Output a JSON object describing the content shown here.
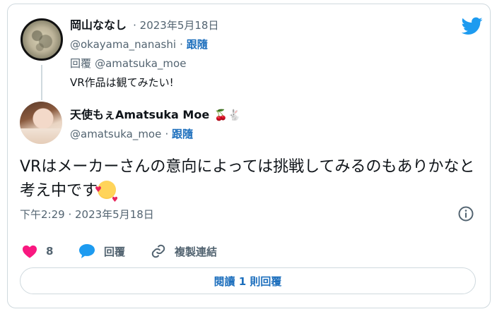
{
  "parent_tweet": {
    "display_name": "岡山ななし",
    "date": "· 2023年5月18日",
    "handle": "@okayama_nanashi",
    "follow_label": "跟隨",
    "replying_to_label": "回覆",
    "replying_to_handle": "@amatsuka_moe",
    "text": "VR作品は観てみたい!"
  },
  "main_tweet": {
    "display_name": "天使もぇAmatsuka Moe",
    "name_emojis": "🍒🐇",
    "handle": "@amatsuka_moe",
    "follow_label": "跟隨",
    "text": "VRはメーカーさんの意向によっては挑戦してみるのもありかなと考え中です",
    "timestamp": "下午2:29 · 2023年5月18日"
  },
  "actions": {
    "like_count": "8",
    "reply_label": "回覆",
    "copy_link_label": "複製連結"
  },
  "read_replies_label": "閱讀 1 則回覆",
  "colors": {
    "twitter_blue": "#1d9bf0",
    "link_blue": "#1d6fbd",
    "like_pink": "#f91880",
    "muted_gray": "#536471",
    "border": "#cfd9de"
  },
  "icons": [
    "twitter-bird-icon",
    "info-icon",
    "heart-icon",
    "speech-bubble-icon",
    "link-icon"
  ]
}
